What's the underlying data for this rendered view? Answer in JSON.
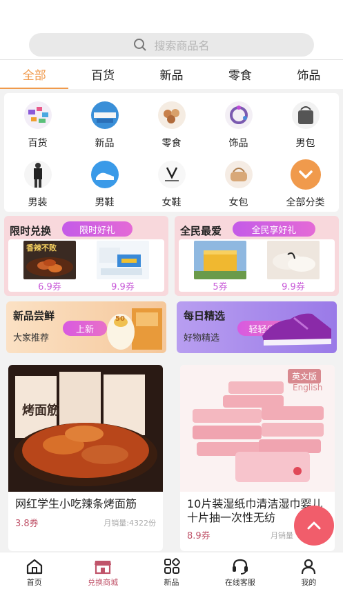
{
  "search": {
    "placeholder": "搜索商品名",
    "icon": "search-icon"
  },
  "tabs": [
    "全部",
    "百货",
    "新品",
    "零食",
    "饰品"
  ],
  "categories": [
    {
      "label": "百货",
      "icon": "goods-icon"
    },
    {
      "label": "新品",
      "icon": "new-icon"
    },
    {
      "label": "零食",
      "icon": "snack-icon"
    },
    {
      "label": "饰品",
      "icon": "jewelry-icon"
    },
    {
      "label": "男包",
      "icon": "mens-bag-icon"
    },
    {
      "label": "男装",
      "icon": "mens-clothing-icon"
    },
    {
      "label": "男鞋",
      "icon": "mens-shoes-icon"
    },
    {
      "label": "女鞋",
      "icon": "womens-shoes-icon"
    },
    {
      "label": "女包",
      "icon": "womens-bag-icon"
    },
    {
      "label": "全部分类",
      "icon": "chevron-down-icon"
    }
  ],
  "promo_left": {
    "title": "限时兑换",
    "tag": "限时好礼",
    "items": [
      {
        "price": "6.9券",
        "img_text": "香辣不败"
      },
      {
        "price": "9.9券"
      }
    ]
  },
  "promo_right": {
    "title": "全民最爱",
    "tag": "全民享好礼",
    "items": [
      {
        "price": "5券"
      },
      {
        "price": "9.9券"
      }
    ]
  },
  "band_left": {
    "title": "新品尝鲜",
    "subtitle": "大家推荐",
    "tag": "上新",
    "img_text": "50"
  },
  "band_right": {
    "title": "每日精选",
    "subtitle": "好物精选",
    "tag": "轻轻省"
  },
  "products": [
    {
      "name": "网红学生小吃辣条烤面筋",
      "price": "3.8券",
      "sold": "月销量:4322份",
      "img_text": "烤面筋"
    },
    {
      "name": "10片装湿纸巾清洁湿巾婴儿十片抽一次性无纺",
      "price": "8.9券",
      "sold": "月销量",
      "badge": "英文版",
      "badge_sub": "English"
    }
  ],
  "nav": [
    {
      "label": "首页",
      "icon": "home-icon"
    },
    {
      "label": "兑换商城",
      "icon": "store-icon"
    },
    {
      "label": "新品",
      "icon": "grid-icon"
    },
    {
      "label": "在线客服",
      "icon": "headset-icon"
    },
    {
      "label": "我的",
      "icon": "user-icon"
    }
  ],
  "colors": {
    "accent": "#f09a4c",
    "pink": "#c85ad8",
    "fab": "#f15d6b"
  }
}
